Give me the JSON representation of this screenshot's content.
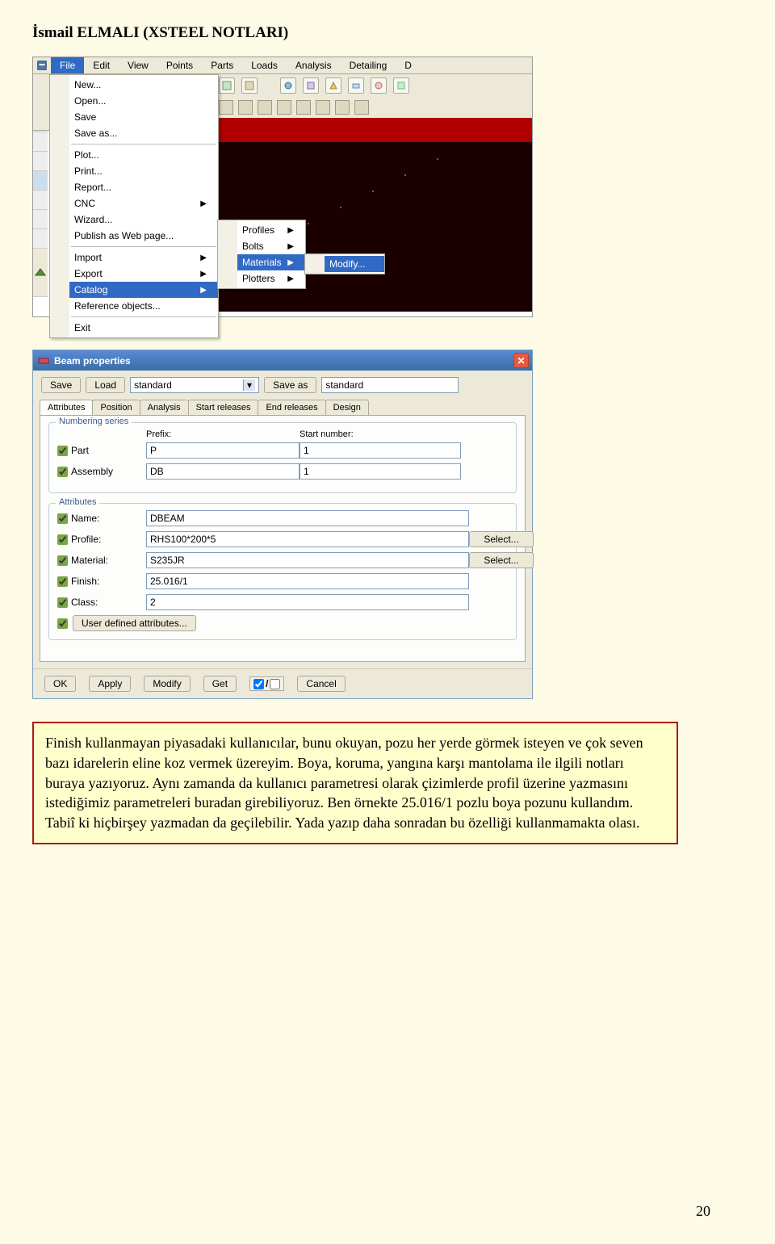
{
  "header": "İsmail ELMALI (XSTEEL NOTLARI)",
  "menubar": {
    "items": [
      "File",
      "Edit",
      "View",
      "Points",
      "Parts",
      "Loads",
      "Analysis",
      "Detailing",
      "D"
    ]
  },
  "file_menu": {
    "group1": [
      "New...",
      "Open...",
      "Save",
      "Save as..."
    ],
    "group2": [
      "Plot...",
      "Print...",
      "Report...",
      "CNC",
      "Wizard...",
      "Publish as Web page..."
    ],
    "group3": [
      "Import",
      "Export",
      "Catalog",
      "Reference objects..."
    ],
    "group4": [
      "Exit"
    ],
    "highlighted": "Catalog"
  },
  "submenu2": {
    "items": [
      "Profiles",
      "Bolts",
      "Materials",
      "Plotters"
    ],
    "highlighted": "Materials"
  },
  "submenu3": {
    "items": [
      "Modify..."
    ]
  },
  "beam_dialog": {
    "title": "Beam properties",
    "buttons": {
      "save": "Save",
      "load": "Load",
      "saveas": "Save as"
    },
    "preset_combo": "standard",
    "preset_text": "standard",
    "tabs": [
      "Attributes",
      "Position",
      "Analysis",
      "Start releases",
      "End releases",
      "Design"
    ],
    "numbering": {
      "legend": "Numbering series",
      "cols": {
        "prefix": "Prefix:",
        "start": "Start number:"
      },
      "rows": [
        {
          "label": "Part",
          "prefix": "P",
          "start": "1"
        },
        {
          "label": "Assembly",
          "prefix": "DB",
          "start": "1"
        }
      ]
    },
    "attributes": {
      "legend": "Attributes",
      "rows": [
        {
          "label": "Name:",
          "value": "DBEAM",
          "select": false
        },
        {
          "label": "Profile:",
          "value": "RHS100*200*5",
          "select": true
        },
        {
          "label": "Material:",
          "value": "S235JR",
          "select": true
        },
        {
          "label": "Finish:",
          "value": "25.016/1",
          "select": false
        },
        {
          "label": "Class:",
          "value": "2",
          "select": false
        }
      ],
      "user_attr": "User defined attributes...",
      "select_label": "Select..."
    },
    "bottom": {
      "ok": "OK",
      "apply": "Apply",
      "modify": "Modify",
      "get": "Get",
      "cancel": "Cancel"
    }
  },
  "note_text": "Finish kullanmayan piyasadaki kullanıcılar, bunu okuyan, pozu her yerde görmek isteyen ve çok seven bazı idarelerin eline koz vermek üzereyim. Boya, koruma, yangına karşı mantolama ile ilgili notları buraya yazıyoruz. Aynı zamanda da kullanıcı parametresi olarak çizimlerde profil üzerine yazmasını istediğimiz parametreleri buradan girebiliyoruz. Ben örnekte 25.016/1 pozlu boya pozunu kullandım. Tabiî ki hiçbirşey yazmadan da geçilebilir. Yada yazıp daha sonradan bu özelliği kullanmamakta olası.",
  "page_number": "20"
}
